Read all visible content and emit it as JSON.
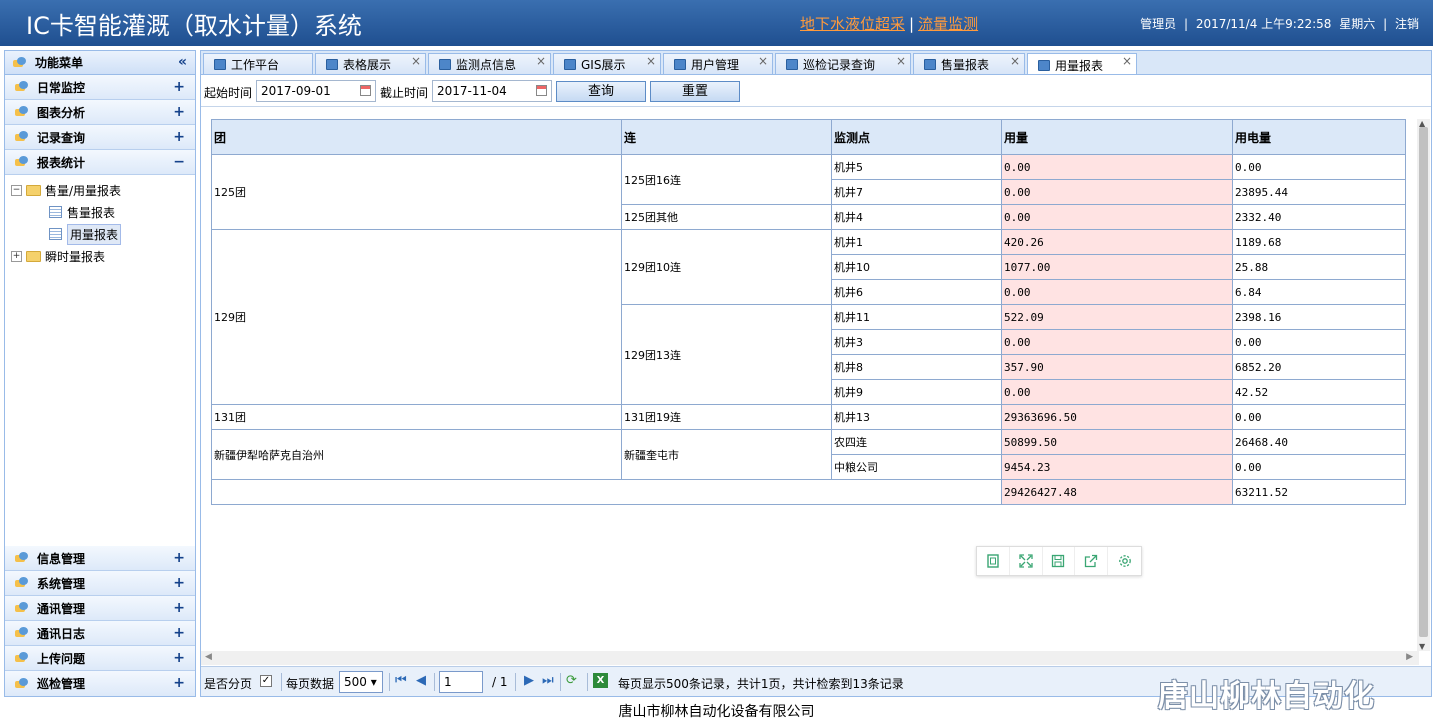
{
  "header": {
    "title": "IC卡智能灌溉（取水计量）系统",
    "link_groundwater": "地下水液位超采",
    "link_sep": "|",
    "link_flow": "流量监测",
    "user": "管理员",
    "date": "2017/11/4 上午9:22:58",
    "weekday": "星期六",
    "logout": "注销",
    "sep": "|"
  },
  "sidebar": {
    "title": "功能菜单",
    "collapse": "«",
    "top_items": [
      {
        "label": "日常监控",
        "toggle": "+"
      },
      {
        "label": "图表分析",
        "toggle": "+"
      },
      {
        "label": "记录查询",
        "toggle": "+"
      },
      {
        "label": "报表统计",
        "toggle": "−"
      }
    ],
    "tree": {
      "folder1": "售量/用量报表",
      "leaf1": "售量报表",
      "leaf2": "用量报表",
      "folder2": "瞬时量报表",
      "minus": "−",
      "plus": "+"
    },
    "bottom_items": [
      {
        "label": "信息管理",
        "toggle": "+"
      },
      {
        "label": "系统管理",
        "toggle": "+"
      },
      {
        "label": "通讯管理",
        "toggle": "+"
      },
      {
        "label": "通讯日志",
        "toggle": "+"
      },
      {
        "label": "上传问题",
        "toggle": "+"
      },
      {
        "label": "巡检管理",
        "toggle": "+"
      }
    ]
  },
  "tabs": [
    {
      "label": "工作平台"
    },
    {
      "label": "表格展示",
      "close": "×"
    },
    {
      "label": "监测点信息",
      "close": "×"
    },
    {
      "label": "GIS展示",
      "close": "×"
    },
    {
      "label": "用户管理",
      "close": "×"
    },
    {
      "label": "巡检记录查询",
      "close": "×"
    },
    {
      "label": "售量报表",
      "close": "×"
    },
    {
      "label": "用量报表",
      "close": "×"
    }
  ],
  "filter": {
    "start_label": "起始时间",
    "start_value": "2017-09-01",
    "end_label": "截止时间",
    "end_value": "2017-11-04",
    "query": "查询",
    "reset": "重置"
  },
  "table": {
    "headers": [
      "团",
      "连",
      "监测点",
      "用量",
      "用电量"
    ],
    "groups": {
      "t125": "125团",
      "t129": "129团",
      "t131": "131团",
      "xj": "新疆伊犁哈萨克自治州",
      "l125_16": "125团16连",
      "l125_other": "125团其他",
      "l129_10": "129团10连",
      "l129_13": "129团13连",
      "l131_19": "131团19连",
      "l_kt": "新疆奎屯市"
    },
    "rows": [
      {
        "point": "机井5",
        "usage": "0.00",
        "power": "0.00"
      },
      {
        "point": "机井7",
        "usage": "0.00",
        "power": "23895.44"
      },
      {
        "point": "机井4",
        "usage": "0.00",
        "power": "2332.40"
      },
      {
        "point": "机井1",
        "usage": "420.26",
        "power": "1189.68"
      },
      {
        "point": "机井10",
        "usage": "1077.00",
        "power": "25.88"
      },
      {
        "point": "机井6",
        "usage": "0.00",
        "power": "6.84"
      },
      {
        "point": "机井11",
        "usage": "522.09",
        "power": "2398.16"
      },
      {
        "point": "机井3",
        "usage": "0.00",
        "power": "0.00"
      },
      {
        "point": "机井8",
        "usage": "357.90",
        "power": "6852.20"
      },
      {
        "point": "机井9",
        "usage": "0.00",
        "power": "42.52"
      },
      {
        "point": "机井13",
        "usage": "29363696.50",
        "power": "0.00"
      },
      {
        "point": "农四连",
        "usage": "50899.50",
        "power": "26468.40"
      },
      {
        "point": "中粮公司",
        "usage": "9454.23",
        "power": "0.00"
      }
    ],
    "total": {
      "usage": "29426427.48",
      "power": "63211.52"
    }
  },
  "pager": {
    "paged_label": "是否分页",
    "checked": "✓",
    "per_page_label": "每页数据",
    "per_page": "500 ▾",
    "page": "1",
    "of": "/ 1",
    "summary": "每页显示500条记录，共计1页，共计检索到13条记录",
    "excel": "X"
  },
  "footer": "唐山市柳林自动化设备有限公司",
  "watermark": "唐山柳林自动化"
}
